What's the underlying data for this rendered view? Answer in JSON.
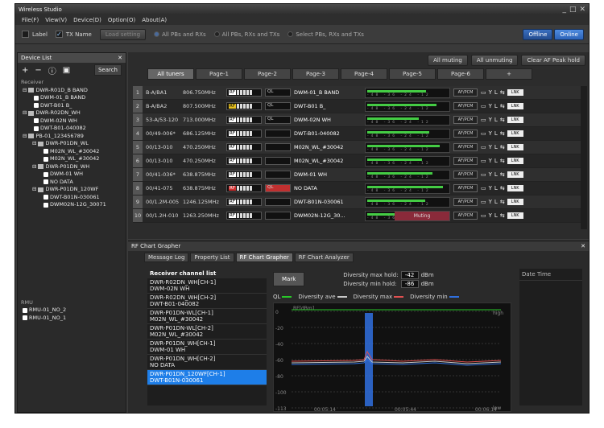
{
  "window": {
    "title": "Wireless Studio"
  },
  "menu": [
    "File(F)",
    "View(V)",
    "Device(D)",
    "Option(O)",
    "About(A)"
  ],
  "toolbar": {
    "label": "Label",
    "tx_name": "TX Name",
    "load_setting": "Load setting",
    "radios": [
      "All PBs and RXs",
      "All PBs, RXs and TXs",
      "Select PBs, RXs and TXs"
    ],
    "offline": "Offline",
    "online": "Online"
  },
  "device_list": {
    "title": "Device List",
    "search": "Search",
    "receiver_header": "Receiver",
    "receivers": [
      {
        "text": "DWR-R01D_B BAND",
        "lvl": 0,
        "type": "rx"
      },
      {
        "text": "DWM-01_B BAND",
        "lvl": 1,
        "type": "d"
      },
      {
        "text": "DWT-B01 B_",
        "lvl": 1,
        "type": "d"
      },
      {
        "text": "DWR-R02DN_WH",
        "lvl": 0,
        "type": "rx"
      },
      {
        "text": "DWM-02N WH",
        "lvl": 1,
        "type": "d"
      },
      {
        "text": "DWT-B01-040082",
        "lvl": 1,
        "type": "d"
      },
      {
        "text": "PB-01_123456789",
        "lvl": 0,
        "type": "pb"
      },
      {
        "text": "DWR-P01DN_WL",
        "lvl": 1,
        "type": "rx"
      },
      {
        "text": "M02N_WL_#30042",
        "lvl": 2,
        "type": "d"
      },
      {
        "text": "M02N_WL_#30042",
        "lvl": 2,
        "type": "d"
      },
      {
        "text": "DWR-P01DN_WH",
        "lvl": 1,
        "type": "rx"
      },
      {
        "text": "DWM-01 WH",
        "lvl": 2,
        "type": "d"
      },
      {
        "text": "NO DATA",
        "lvl": 2,
        "type": "d"
      },
      {
        "text": "DWR-P01DN_120WF",
        "lvl": 1,
        "type": "rx"
      },
      {
        "text": "DWT-B01N-030061",
        "lvl": 2,
        "type": "d"
      },
      {
        "text": "DWM02N-12G_30071",
        "lvl": 2,
        "type": "d"
      }
    ],
    "rmu_header": "RMU",
    "rmu": [
      "RMU-01_NO_2",
      "RMU-01_NO_1"
    ]
  },
  "main": {
    "top_buttons": [
      "All muting",
      "All unmuting",
      "Clear AF Peak hold"
    ],
    "tabs": [
      "All tuners",
      "Page-1",
      "Page-2",
      "Page-3",
      "Page-4",
      "Page-5",
      "Page-6",
      "+"
    ],
    "rows": [
      {
        "n": "1",
        "ch": "B-A/BA1",
        "freq": "806.750MHz",
        "rftag": "",
        "ql": "QL",
        "qlred": false,
        "tx": "DWM-01_B BAND",
        "muting": false
      },
      {
        "n": "2",
        "ch": "B-A/BA2",
        "freq": "807.500MHz",
        "rftag": "RF",
        "ql": "QL",
        "qlred": false,
        "tx": "DWT-B01 B_",
        "muting": false
      },
      {
        "n": "3",
        "ch": "53-A/53-120",
        "freq": "713.000MHz",
        "rftag": "",
        "ql": "QL",
        "qlred": false,
        "tx": "DWM-02N WH",
        "muting": false
      },
      {
        "n": "4",
        "ch": "00/49-006*",
        "freq": "686.125MHz",
        "rftag": "",
        "ql": "",
        "qlred": false,
        "tx": "DWT-B01-040082",
        "muting": false
      },
      {
        "n": "5",
        "ch": "00/13-010",
        "freq": "470.250MHz",
        "rftag": "",
        "ql": "",
        "qlred": false,
        "tx": "M02N_WL_#30042",
        "muting": false
      },
      {
        "n": "6",
        "ch": "00/13-010",
        "freq": "470.250MHz",
        "rftag": "",
        "ql": "",
        "qlred": false,
        "tx": "M02N_WL_#30042",
        "muting": false
      },
      {
        "n": "7",
        "ch": "00/41-036*",
        "freq": "638.875MHz",
        "rftag": "",
        "ql": "",
        "qlred": false,
        "tx": "DWM-01 WH",
        "muting": false
      },
      {
        "n": "8",
        "ch": "00/41-075",
        "freq": "638.875MHz",
        "rftag": "RF",
        "ql": "QL",
        "qlred": true,
        "tx": "NO DATA",
        "muting": false
      },
      {
        "n": "9",
        "ch": "00/1.2M-005",
        "freq": "1246.125MHz",
        "rftag": "",
        "ql": "",
        "qlred": false,
        "tx": "DWT-B01N-030061",
        "muting": false
      },
      {
        "n": "10",
        "ch": "00/1.2H-010",
        "freq": "1263.250MHz",
        "rftag": "",
        "ql": "",
        "qlred": false,
        "tx": "DWM02N-12G_30...",
        "muting": true
      }
    ],
    "meter_scale": "-48 -36 -24 -12",
    "muting_label": "Muting",
    "pcm": "AF/PCM",
    "link": "LNK"
  },
  "grapher": {
    "title": "RF Chart Grapher",
    "tabs": [
      "Message Log",
      "Property List",
      "RF Chart Grapher",
      "RF Chart Analyzer"
    ],
    "list_header": "Receiver channel list",
    "channels": [
      {
        "a": "DWR-R02DN_WH[CH-1]",
        "b": "DWM-02N WH",
        "sel": false
      },
      {
        "a": "DWR-R02DN_WH[CH-2]",
        "b": "DWT-B01-040082",
        "sel": false
      },
      {
        "a": "DWR-P01DN-WL[CH-1]",
        "b": "M02N_WL_#30042",
        "sel": false
      },
      {
        "a": "DWR-P01DN-WL[CH-2]",
        "b": "M02N_WL_#30042",
        "sel": false
      },
      {
        "a": "DWR-P01DN_WH[CH-1]",
        "b": "DWM-01 WH",
        "sel": false
      },
      {
        "a": "DWR-P01DN_WH[CH-2]",
        "b": "NO DATA",
        "sel": false
      },
      {
        "a": "DWR-P01DN_120WF[CH-1]",
        "b": "DWT-B01N-030061",
        "sel": true
      }
    ],
    "mark": "Mark",
    "div_max_label": "Diversity max hold:",
    "div_max": "-42",
    "div_min_label": "Diversity min hold:",
    "div_min": "-86",
    "unit": "dBm",
    "legend": [
      {
        "name": "QL",
        "color": "#28c828"
      },
      {
        "name": "Diversity ave",
        "color": "#c8c8c8"
      },
      {
        "name": "Diversity max",
        "color": "#e05050"
      },
      {
        "name": "Diversity min",
        "color": "#3070e0"
      }
    ],
    "y_label": "RF[dBm]",
    "y_ticks": [
      "0",
      "-20",
      "-40",
      "-60",
      "-80",
      "-100",
      "-113"
    ],
    "x_ticks": [
      "00:05:14",
      "00:05:44",
      "00:06:14"
    ],
    "high": "high",
    "low": "low",
    "date_time": "Date Time"
  }
}
